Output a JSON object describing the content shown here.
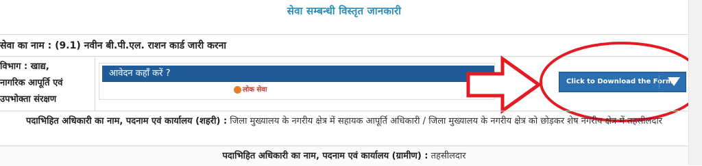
{
  "page": {
    "heading": "सेवा सम्बन्धी विस्तृत जानकारी"
  },
  "service": {
    "name": "सेवा का नाम : (9.1) नवीन बी.पी.एल. राशन कार्ड जारी करना",
    "department_lines": [
      "विभाग : खाद्य,",
      "नागरिक आपूर्ति एवं",
      "उपभोक्ता संरक्षण"
    ]
  },
  "apply": {
    "title": "आवेदन कहाँ करें ?",
    "logo_text": "लोक सेवा"
  },
  "download": {
    "label": "Click to Download the Form"
  },
  "officer_urban": {
    "label": "पदाभिहित अधिकारी का नाम, पदनाम एवं कार्यालय (शहरी) :",
    "value": "जिला मुख्यालय के नगरीय क्षेत्र में सहायक आपूर्ति अधिकारी / जिला मुख्यालय के नगरीय क्षेत्र को छोड़कर शेष नगरीय क्षेत्र में तहसीलदार"
  },
  "officer_rural": {
    "label": "पदाभिहित अधिकारी का नाम, पदनाम एवं कार्यालय (ग्रामीण) :",
    "value": "तहसीलदार"
  },
  "annotations": {
    "arrow_color": "#e31b23",
    "circle_color": "#e31b23"
  }
}
